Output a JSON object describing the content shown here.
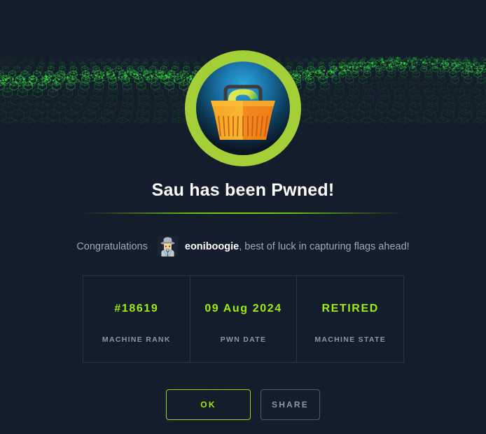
{
  "colors": {
    "background": "#141d2b",
    "accent_green": "#9fef00",
    "ring_green": "#a4d037",
    "muted_text": "#9aa9bd",
    "border": "#2a3442",
    "share_border": "#4a5a75"
  },
  "banner": {
    "name": "cube-terrain-banner",
    "pattern": "green-wireframe-cubes"
  },
  "avatar": {
    "name": "machine-avatar",
    "icon": "shopping-basket-s-logo",
    "ring_color": "#a4d037"
  },
  "title": "Sau has been Pwned!",
  "congrats": {
    "lead": "Congratulations",
    "user_avatar_icon": "detective-emoji-avatar",
    "username": "eoniboogie",
    "tail": ", best of luck in capturing flags ahead!"
  },
  "stats": [
    {
      "value": "#18619",
      "label": "MACHINE RANK"
    },
    {
      "value": "09 Aug 2024",
      "label": "PWN DATE"
    },
    {
      "value": "RETIRED",
      "label": "MACHINE STATE"
    }
  ],
  "buttons": {
    "ok": "OK",
    "share": "SHARE"
  }
}
